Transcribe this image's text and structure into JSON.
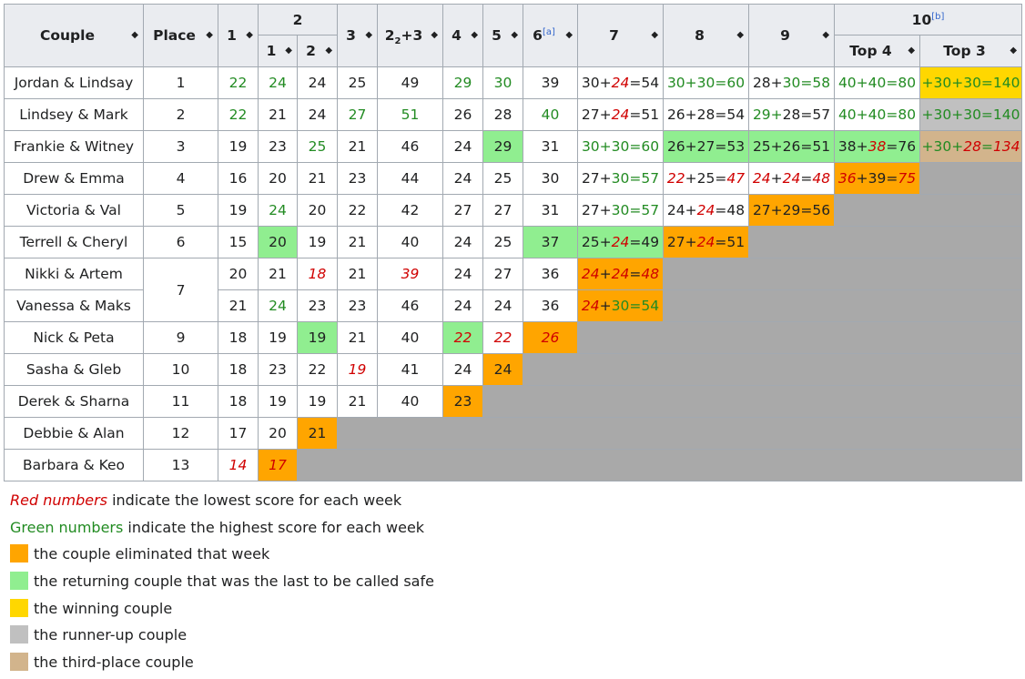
{
  "columns": {
    "couple": "Couple",
    "place": "Place",
    "w1": "1",
    "w2": "2",
    "w2a": "1",
    "w2b": "2",
    "w3": "3",
    "w23": {
      "main": "2",
      "sub": "2",
      "rest": "+3"
    },
    "w4": "4",
    "w5": "5",
    "w6": {
      "label": "6",
      "note": "[a]"
    },
    "w7": "7",
    "w8": "8",
    "w9": "9",
    "w10": {
      "label": "10",
      "note": "[b]"
    },
    "top4": "Top 4",
    "top3": "Top 3"
  },
  "sort_icon": "sort-icon",
  "colors": {
    "eliminated": "#ffa500",
    "last_safe": "#90ee90",
    "winner": "#ffd700",
    "runner_up": "#c0c0c0",
    "third": "#d2b48c",
    "lowest_text": "#d00000",
    "highest_text": "#228b22",
    "no_score": "#a9a9a9"
  },
  "rows": [
    {
      "couple": "Jordan & Lindsay",
      "place": "1",
      "scores": [
        {
          "v": "22",
          "s": "g"
        },
        {
          "v": "24",
          "s": "g"
        },
        {
          "v": "24"
        },
        {
          "v": "25"
        },
        {
          "v": "49"
        },
        {
          "v": "29",
          "s": "g"
        },
        {
          "v": "30",
          "s": "g"
        },
        {
          "v": "39"
        },
        {
          "parts": [
            {
              "t": "30+"
            },
            {
              "t": "24",
              "s": "r"
            },
            {
              "t": "=54"
            }
          ]
        },
        {
          "parts": [
            {
              "t": "30+30=60",
              "s": "g"
            }
          ]
        },
        {
          "parts": [
            {
              "t": "28+"
            },
            {
              "t": "30=58",
              "s": "g"
            }
          ]
        },
        {
          "parts": [
            {
              "t": "40+40=80",
              "s": "g"
            }
          ]
        },
        {
          "parts": [
            {
              "t": "+30+30=140",
              "s": "g"
            }
          ],
          "bg": "gold"
        }
      ]
    },
    {
      "couple": "Lindsey & Mark",
      "place": "2",
      "scores": [
        {
          "v": "22",
          "s": "g"
        },
        {
          "v": "21"
        },
        {
          "v": "24"
        },
        {
          "v": "27",
          "s": "g"
        },
        {
          "v": "51",
          "s": "g"
        },
        {
          "v": "26"
        },
        {
          "v": "28"
        },
        {
          "v": "40",
          "s": "g"
        },
        {
          "parts": [
            {
              "t": "27+"
            },
            {
              "t": "24",
              "s": "r"
            },
            {
              "t": "=51"
            }
          ]
        },
        {
          "parts": [
            {
              "t": "26+28=54"
            }
          ]
        },
        {
          "parts": [
            {
              "t": "29+",
              "s": "g"
            },
            {
              "t": "28=57"
            }
          ]
        },
        {
          "parts": [
            {
              "t": "40+40=80",
              "s": "g"
            }
          ]
        },
        {
          "parts": [
            {
              "t": "+30+30=140",
              "s": "g"
            }
          ],
          "bg": "silver"
        }
      ]
    },
    {
      "couple": "Frankie & Witney",
      "place": "3",
      "scores": [
        {
          "v": "19"
        },
        {
          "v": "23"
        },
        {
          "v": "25",
          "s": "g"
        },
        {
          "v": "21"
        },
        {
          "v": "46"
        },
        {
          "v": "24"
        },
        {
          "v": "29",
          "bg": "green"
        },
        {
          "v": "31"
        },
        {
          "parts": [
            {
              "t": "30+30=60",
              "s": "g"
            }
          ]
        },
        {
          "parts": [
            {
              "t": "26+27=53"
            }
          ],
          "bg": "green"
        },
        {
          "parts": [
            {
              "t": "25+26=51"
            }
          ],
          "bg": "green"
        },
        {
          "parts": [
            {
              "t": "38+"
            },
            {
              "t": "38",
              "s": "r"
            },
            {
              "t": "=76"
            }
          ],
          "bg": "green"
        },
        {
          "parts": [
            {
              "t": "+30+",
              "s": "g"
            },
            {
              "t": "28",
              "s": "r"
            },
            {
              "t": "=",
              "s": "g"
            },
            {
              "t": "134",
              "s": "r"
            }
          ],
          "bg": "bronze"
        }
      ]
    },
    {
      "couple": "Drew & Emma",
      "place": "4",
      "scores": [
        {
          "v": "16"
        },
        {
          "v": "20"
        },
        {
          "v": "21"
        },
        {
          "v": "23"
        },
        {
          "v": "44"
        },
        {
          "v": "24"
        },
        {
          "v": "25"
        },
        {
          "v": "30"
        },
        {
          "parts": [
            {
              "t": "27+"
            },
            {
              "t": "30=57",
              "s": "g"
            }
          ]
        },
        {
          "parts": [
            {
              "t": "22",
              "s": "r"
            },
            {
              "t": "+25="
            },
            {
              "t": "47",
              "s": "r"
            }
          ]
        },
        {
          "parts": [
            {
              "t": "24",
              "s": "r"
            },
            {
              "t": "+"
            },
            {
              "t": "24",
              "s": "r"
            },
            {
              "t": "="
            },
            {
              "t": "48",
              "s": "r"
            }
          ]
        },
        {
          "parts": [
            {
              "t": "36",
              "s": "r"
            },
            {
              "t": "+39="
            },
            {
              "t": "75",
              "s": "r"
            }
          ],
          "bg": "orange"
        }
      ]
    },
    {
      "couple": "Victoria & Val",
      "place": "5",
      "scores": [
        {
          "v": "19"
        },
        {
          "v": "24",
          "s": "g"
        },
        {
          "v": "20"
        },
        {
          "v": "22"
        },
        {
          "v": "42"
        },
        {
          "v": "27"
        },
        {
          "v": "27"
        },
        {
          "v": "31"
        },
        {
          "parts": [
            {
              "t": "27+"
            },
            {
              "t": "30=57",
              "s": "g"
            }
          ]
        },
        {
          "parts": [
            {
              "t": "24+"
            },
            {
              "t": "24",
              "s": "r"
            },
            {
              "t": "=48"
            }
          ]
        },
        {
          "parts": [
            {
              "t": "27+29=56"
            }
          ],
          "bg": "orange"
        }
      ]
    },
    {
      "couple": "Terrell & Cheryl",
      "place": "6",
      "scores": [
        {
          "v": "15"
        },
        {
          "v": "20",
          "bg": "green"
        },
        {
          "v": "19"
        },
        {
          "v": "21"
        },
        {
          "v": "40"
        },
        {
          "v": "24"
        },
        {
          "v": "25"
        },
        {
          "v": "37",
          "bg": "green"
        },
        {
          "parts": [
            {
              "t": "25+"
            },
            {
              "t": "24",
              "s": "r"
            },
            {
              "t": "=49"
            }
          ],
          "bg": "green"
        },
        {
          "parts": [
            {
              "t": "27+"
            },
            {
              "t": "24",
              "s": "r"
            },
            {
              "t": "=51"
            }
          ],
          "bg": "orange"
        }
      ]
    },
    {
      "couple": "Nikki & Artem",
      "place": "7",
      "placeSpan": 2,
      "scores": [
        {
          "v": "20"
        },
        {
          "v": "21"
        },
        {
          "v": "18",
          "s": "r"
        },
        {
          "v": "21"
        },
        {
          "v": "39",
          "s": "r"
        },
        {
          "v": "24"
        },
        {
          "v": "27"
        },
        {
          "v": "36"
        },
        {
          "parts": [
            {
              "t": "24",
              "s": "r"
            },
            {
              "t": "+"
            },
            {
              "t": "24",
              "s": "r"
            },
            {
              "t": "="
            },
            {
              "t": "48",
              "s": "r"
            }
          ],
          "bg": "orange"
        }
      ]
    },
    {
      "couple": "Vanessa & Maks",
      "place": "",
      "placeSkip": true,
      "scores": [
        {
          "v": "21"
        },
        {
          "v": "24",
          "s": "g"
        },
        {
          "v": "23"
        },
        {
          "v": "23"
        },
        {
          "v": "46"
        },
        {
          "v": "24"
        },
        {
          "v": "24"
        },
        {
          "v": "36"
        },
        {
          "parts": [
            {
              "t": "24",
              "s": "r"
            },
            {
              "t": "+"
            },
            {
              "t": "30=54",
              "s": "g"
            }
          ],
          "bg": "orange"
        }
      ]
    },
    {
      "couple": "Nick & Peta",
      "place": "9",
      "scores": [
        {
          "v": "18"
        },
        {
          "v": "19"
        },
        {
          "v": "19",
          "bg": "green"
        },
        {
          "v": "21"
        },
        {
          "v": "40"
        },
        {
          "v": "22",
          "s": "r",
          "bg": "green"
        },
        {
          "v": "22",
          "s": "r"
        },
        {
          "v": "26",
          "s": "r",
          "bg": "orange"
        }
      ]
    },
    {
      "couple": "Sasha & Gleb",
      "place": "10",
      "scores": [
        {
          "v": "18"
        },
        {
          "v": "23"
        },
        {
          "v": "22"
        },
        {
          "v": "19",
          "s": "r"
        },
        {
          "v": "41"
        },
        {
          "v": "24"
        },
        {
          "v": "24",
          "bg": "orange"
        }
      ]
    },
    {
      "couple": "Derek & Sharna",
      "place": "11",
      "scores": [
        {
          "v": "18"
        },
        {
          "v": "19"
        },
        {
          "v": "19"
        },
        {
          "v": "21"
        },
        {
          "v": "40"
        },
        {
          "v": "23",
          "bg": "orange"
        }
      ]
    },
    {
      "couple": "Debbie & Alan",
      "place": "12",
      "scores": [
        {
          "v": "17"
        },
        {
          "v": "20"
        },
        {
          "v": "21",
          "bg": "orange"
        }
      ]
    },
    {
      "couple": "Barbara & Keo",
      "place": "13",
      "scores": [
        {
          "v": "14",
          "s": "r"
        },
        {
          "v": "17",
          "s": "r",
          "bg": "orange"
        }
      ]
    }
  ],
  "legend": {
    "red_lead": "Red numbers",
    "red_rest": " indicate the lowest score for each week",
    "green_lead": "Green numbers",
    "green_rest": " indicate the highest score for each week",
    "items": [
      {
        "color": "#ffa500",
        "label": "the couple eliminated that week"
      },
      {
        "color": "#90ee90",
        "label": "the returning couple that was the last to be called safe"
      },
      {
        "color": "#ffd700",
        "label": "the winning couple"
      },
      {
        "color": "#c0c0c0",
        "label": "the runner-up couple"
      },
      {
        "color": "#d2b48c",
        "label": "the third-place couple"
      }
    ]
  }
}
